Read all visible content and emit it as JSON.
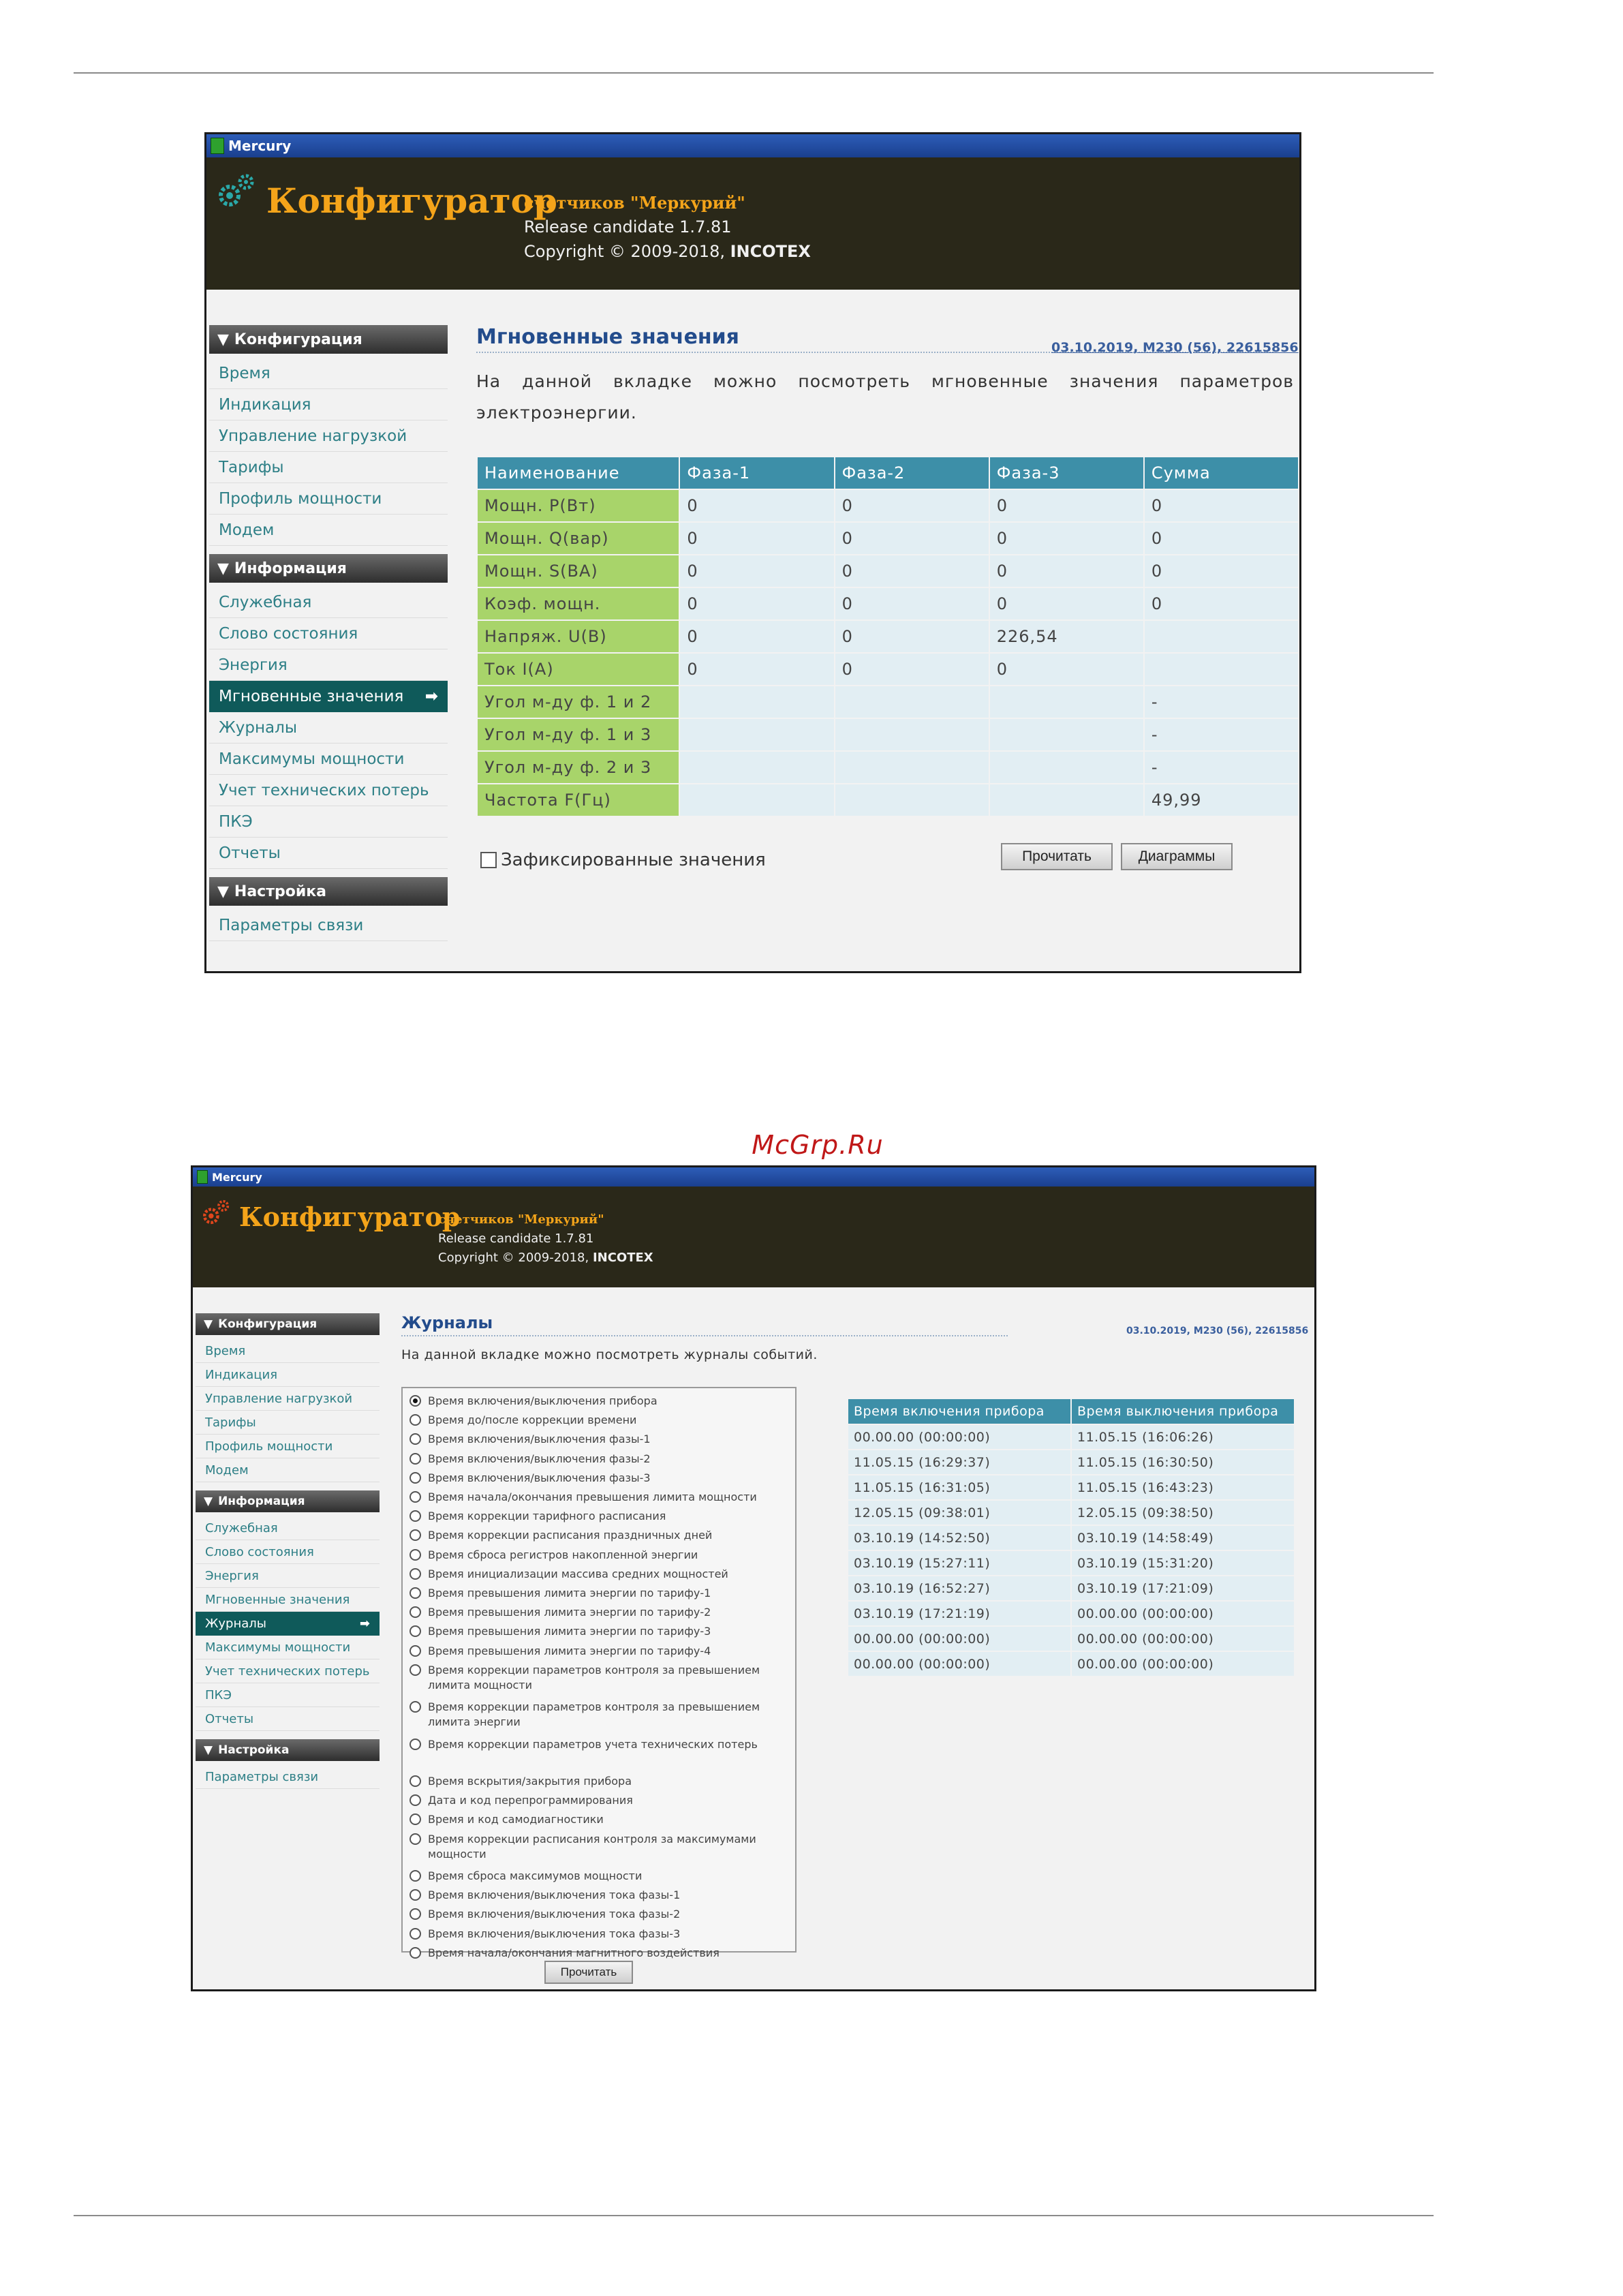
{
  "watermark": "McGrp.Ru",
  "app": {
    "window_title": "Mercury",
    "logo": "Конфигуратор",
    "subtitle": "счетчиков \"Меркурий\"",
    "release": "Release candidate 1.7.81",
    "copyright_prefix": "Copyright © 2009-2018, ",
    "copyright_company": "INCOTEX"
  },
  "sidebar": {
    "sections": [
      {
        "title": "Конфигурация",
        "items": [
          "Время",
          "Индикация",
          "Управление нагрузкой",
          "Тарифы",
          "Профиль мощности",
          "Модем"
        ]
      },
      {
        "title": "Информация",
        "items": [
          "Служебная",
          "Слово состояния",
          "Энергия",
          "Мгновенные значения",
          "Журналы",
          "Максимумы мощности",
          "Учет технических потерь",
          "ПКЭ",
          "Отчеты"
        ]
      },
      {
        "title": "Настройка",
        "items": [
          "Параметры связи"
        ]
      }
    ],
    "active_arrow": "➡"
  },
  "screen1": {
    "active_item": "Мгновенные значения",
    "title": "Мгновенные значения",
    "meta": "03.10.2019, M230 (56), 22615856",
    "description": "На данной вкладке можно посмотреть мгновенные значения параметров электроэнергии.",
    "table": {
      "headers": [
        "Наименование",
        "Фаза-1",
        "Фаза-2",
        "Фаза-3",
        "Сумма"
      ],
      "rows": [
        [
          "Мощн. P(Вт)",
          "0",
          "0",
          "0",
          "0"
        ],
        [
          "Мощн. Q(вар)",
          "0",
          "0",
          "0",
          "0"
        ],
        [
          "Мощн. S(ВА)",
          "0",
          "0",
          "0",
          "0"
        ],
        [
          "Коэф. мощн.",
          "0",
          "0",
          "0",
          "0"
        ],
        [
          "Напряж. U(В)",
          "0",
          "0",
          "226,54",
          ""
        ],
        [
          "Ток I(А)",
          "0",
          "0",
          "0",
          ""
        ],
        [
          "Угол м-ду ф. 1 и 2",
          "",
          "",
          "",
          "-"
        ],
        [
          "Угол м-ду ф. 1 и 3",
          "",
          "",
          "",
          "-"
        ],
        [
          "Угол м-ду ф. 2 и 3",
          "",
          "",
          "",
          "-"
        ],
        [
          "Частота F(Гц)",
          "",
          "",
          "",
          "49,99"
        ]
      ]
    },
    "checkbox_label": "Зафиксированные значения",
    "checkbox_checked": false,
    "read_button": "Прочитать",
    "charts_button": "Диаграммы"
  },
  "screen2": {
    "active_item": "Журналы",
    "title": "Журналы",
    "meta": "03.10.2019, M230 (56), 22615856",
    "description": "На данной вкладке можно посмотреть журналы событий.",
    "journals": [
      "Время включения/выключения прибора",
      "Время до/после коррекции времени",
      "Время включения/выключения фазы-1",
      "Время включения/выключения фазы-2",
      "Время включения/выключения фазы-3",
      "Время начала/окончания превышения лимита мощности",
      "Время коррекции тарифного расписания",
      "Время коррекции расписания праздничных дней",
      "Время сброса регистров накопленной энергии",
      "Время инициализации массива средних мощностей",
      "Время превышения лимита энергии по тарифу-1",
      "Время превышения лимита энергии по тарифу-2",
      "Время превышения лимита энергии по тарифу-3",
      "Время превышения лимита энергии по тарифу-4",
      "Время коррекции параметров контроля за превышением лимита мощности",
      "Время коррекции параметров контроля за превышением лимита энергии",
      "Время коррекции параметров учета технических потерь",
      "Время вскрытия/закрытия прибора",
      "Дата и код перепрограммирования",
      "Время и код самодиагностики",
      "Время коррекции расписания контроля за максимумами мощности",
      "Время сброса максимумов мощности",
      "Время включения/выключения тока фазы-1",
      "Время включения/выключения тока фазы-2",
      "Время включения/выключения тока фазы-3",
      "Время начала/окончания магнитного воздействия"
    ],
    "selected_index": 0,
    "events_table": {
      "headers": [
        "Время включения прибора",
        "Время выключения прибора"
      ],
      "rows": [
        [
          "00.00.00 (00:00:00)",
          "11.05.15 (16:06:26)"
        ],
        [
          "11.05.15 (16:29:37)",
          "11.05.15 (16:30:50)"
        ],
        [
          "11.05.15 (16:31:05)",
          "11.05.15 (16:43:23)"
        ],
        [
          "12.05.15 (09:38:01)",
          "12.05.15 (09:38:50)"
        ],
        [
          "03.10.19 (14:52:50)",
          "03.10.19 (14:58:49)"
        ],
        [
          "03.10.19 (15:27:11)",
          "03.10.19 (15:31:20)"
        ],
        [
          "03.10.19 (16:52:27)",
          "03.10.19 (17:21:09)"
        ],
        [
          "03.10.19 (17:21:19)",
          "00.00.00 (00:00:00)"
        ],
        [
          "00.00.00 (00:00:00)",
          "00.00.00 (00:00:00)"
        ],
        [
          "00.00.00 (00:00:00)",
          "00.00.00 (00:00:00)"
        ]
      ]
    },
    "read_button": "Прочитать"
  }
}
